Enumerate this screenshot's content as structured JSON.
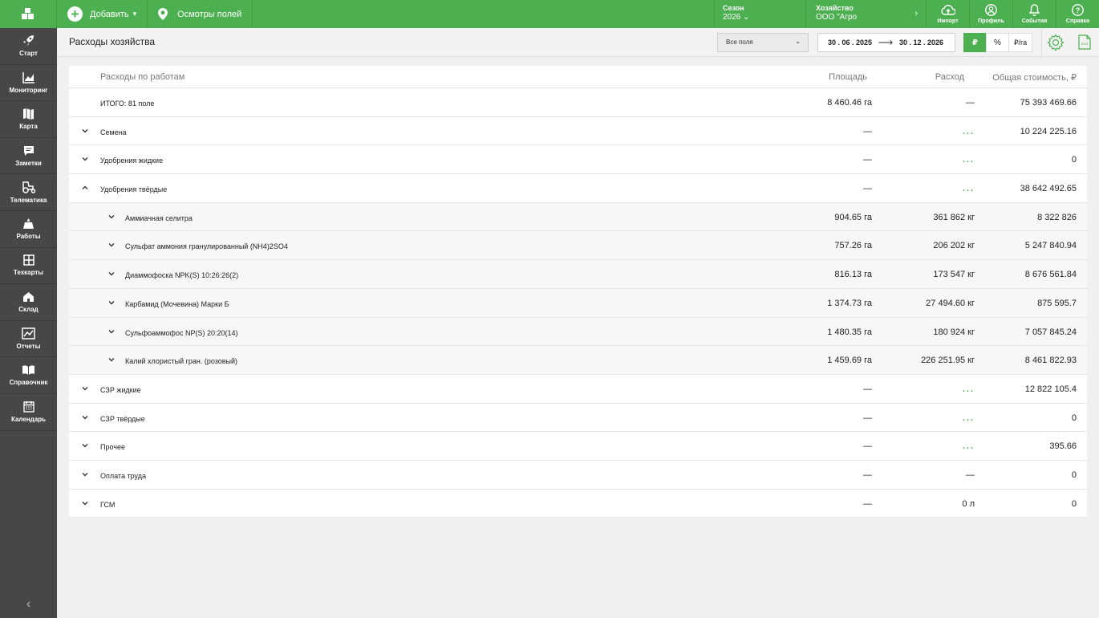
{
  "topbar": {
    "add_label": "Добавить",
    "inspections_label": "Осмотры полей",
    "season_label": "Сезон",
    "season_value": "2026",
    "farm_label": "Хозяйство",
    "farm_value": "ООО \"Агро",
    "import_label": "Импорт",
    "profile_label": "Профиль",
    "events_label": "События",
    "help_label": "Справка"
  },
  "sidebar": {
    "items": [
      {
        "label": "Старт",
        "icon": "rocket-icon"
      },
      {
        "label": "Мониторинг",
        "icon": "chart-icon"
      },
      {
        "label": "Карта",
        "icon": "map-icon"
      },
      {
        "label": "Заметки",
        "icon": "note-icon"
      },
      {
        "label": "Телематика",
        "icon": "tractor-icon"
      },
      {
        "label": "Работы",
        "icon": "works-icon"
      },
      {
        "label": "Техкарты",
        "icon": "grid-icon"
      },
      {
        "label": "Склад",
        "icon": "warehouse-icon"
      },
      {
        "label": "Отчеты",
        "icon": "reports-icon"
      },
      {
        "label": "Справочник",
        "icon": "book-icon"
      },
      {
        "label": "Календарь",
        "icon": "calendar-icon"
      }
    ],
    "collapse_glyph": "‹"
  },
  "header": {
    "title": "Расходы хозяйства",
    "fields_select": "Все поля",
    "date_from": "30 . 06 . 2025",
    "date_to": "30 . 12 . 2026",
    "unit_rub": "₽",
    "unit_percent": "%",
    "unit_rub_ha": "₽/га",
    "accent_color": "#4caf50"
  },
  "table": {
    "headers": {
      "name": "Расходы по работам",
      "area": "Площадь",
      "usage": "Расход",
      "cost": "Общая стоимость, ₽"
    },
    "total": {
      "name": "ИТОГО: 81 поле",
      "area": "8 460.46 га",
      "usage": "—",
      "cost": "75 393 469.66"
    },
    "rows": [
      {
        "name": "Семена",
        "area": "—",
        "usage": "...",
        "cost": "10 224 225.16",
        "expanded": false,
        "level": 0
      },
      {
        "name": "Удобрения жидкие",
        "area": "—",
        "usage": "...",
        "cost": "0",
        "expanded": false,
        "level": 0
      },
      {
        "name": "Удобрения твёрдые",
        "area": "—",
        "usage": "...",
        "cost": "38 642 492.65",
        "expanded": true,
        "level": 0
      },
      {
        "name": "Аммиачная селитра",
        "area": "904.65 га",
        "usage": "361 862 кг",
        "cost": "8 322 826",
        "expanded": false,
        "level": 1
      },
      {
        "name": "Сульфат аммония гранулированный (NH4)2SO4",
        "area": "757.26 га",
        "usage": "206 202 кг",
        "cost": "5 247 840.94",
        "expanded": false,
        "level": 1
      },
      {
        "name": "Диаммофоска NPK(S) 10:26:26(2)",
        "area": "816.13 га",
        "usage": "173 547 кг",
        "cost": "8 676 561.84",
        "expanded": false,
        "level": 1
      },
      {
        "name": "Карбамид (Мочевина) Марки Б",
        "area": "1 374.73 га",
        "usage": "27 494.60 кг",
        "cost": "875 595.7",
        "expanded": false,
        "level": 1
      },
      {
        "name": "Сульфоаммофос NP(S) 20:20(14)",
        "area": "1 480.35 га",
        "usage": "180 924 кг",
        "cost": "7 057 845.24",
        "expanded": false,
        "level": 1
      },
      {
        "name": "Калий хлористый гран. (розовый)",
        "area": "1 459.69 га",
        "usage": "226 251.95 кг",
        "cost": "8 461 822.93",
        "expanded": false,
        "level": 1
      },
      {
        "name": "СЗР жидкие",
        "area": "—",
        "usage": "...",
        "cost": "12 822 105.4",
        "expanded": false,
        "level": 0
      },
      {
        "name": "СЗР твёрдые",
        "area": "—",
        "usage": "...",
        "cost": "0",
        "expanded": false,
        "level": 0
      },
      {
        "name": "Прочее",
        "area": "—",
        "usage": "...",
        "cost": "395.66",
        "expanded": false,
        "level": 0
      },
      {
        "name": "Оплата труда",
        "area": "—",
        "usage": "—",
        "cost": "0",
        "expanded": false,
        "level": 0
      },
      {
        "name": "ГСМ",
        "area": "—",
        "usage": "0 л",
        "cost": "0",
        "expanded": false,
        "level": 0
      }
    ]
  }
}
